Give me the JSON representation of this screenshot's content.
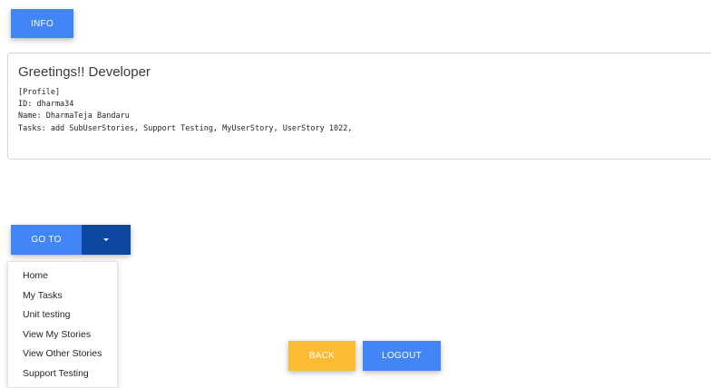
{
  "info_button": {
    "label": "INFO"
  },
  "card": {
    "title": "Greetings!! Developer",
    "lines": [
      "[Profile]",
      "ID: dharma34",
      "Name: DharmaTeja Bandaru",
      "Tasks: add SubUserStories, Support Testing, MyUserStory, UserStory 1022,"
    ]
  },
  "goto": {
    "label": "GO TO",
    "toggle_icon": "caret-down-icon"
  },
  "menu": {
    "items": [
      {
        "label": "Home"
      },
      {
        "label": "My Tasks"
      },
      {
        "label": "Unit testing"
      },
      {
        "label": "View My Stories"
      },
      {
        "label": "View Other Stories"
      },
      {
        "label": "Support Testing"
      }
    ]
  },
  "actions": {
    "back_label": "BACK",
    "logout_label": "LOGOUT"
  },
  "colors": {
    "primary": "#4285f4",
    "primary_dark": "#0d47a1",
    "warning": "#fbbc34"
  }
}
